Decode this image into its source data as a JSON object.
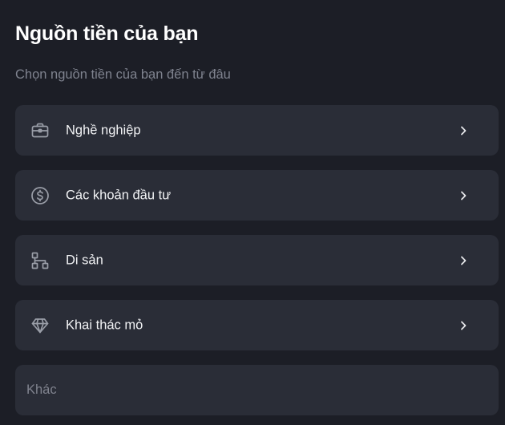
{
  "header": {
    "title": "Nguồn tiền của bạn",
    "subtitle": "Chọn nguồn tiền của bạn đến từ đâu"
  },
  "options": [
    {
      "label": "Nghề nghiệp",
      "icon": "briefcase-icon"
    },
    {
      "label": "Các khoản đầu tư",
      "icon": "dollar-circle-icon"
    },
    {
      "label": "Di sản",
      "icon": "hierarchy-icon"
    },
    {
      "label": "Khai thác mỏ",
      "icon": "diamond-icon"
    }
  ],
  "other": {
    "placeholder": "Khác",
    "value": ""
  },
  "colors": {
    "background": "#1c1e26",
    "card": "#2a2d37",
    "text": "#f2f3f5",
    "muted": "#7f838f",
    "icon": "#9a9ea8"
  }
}
